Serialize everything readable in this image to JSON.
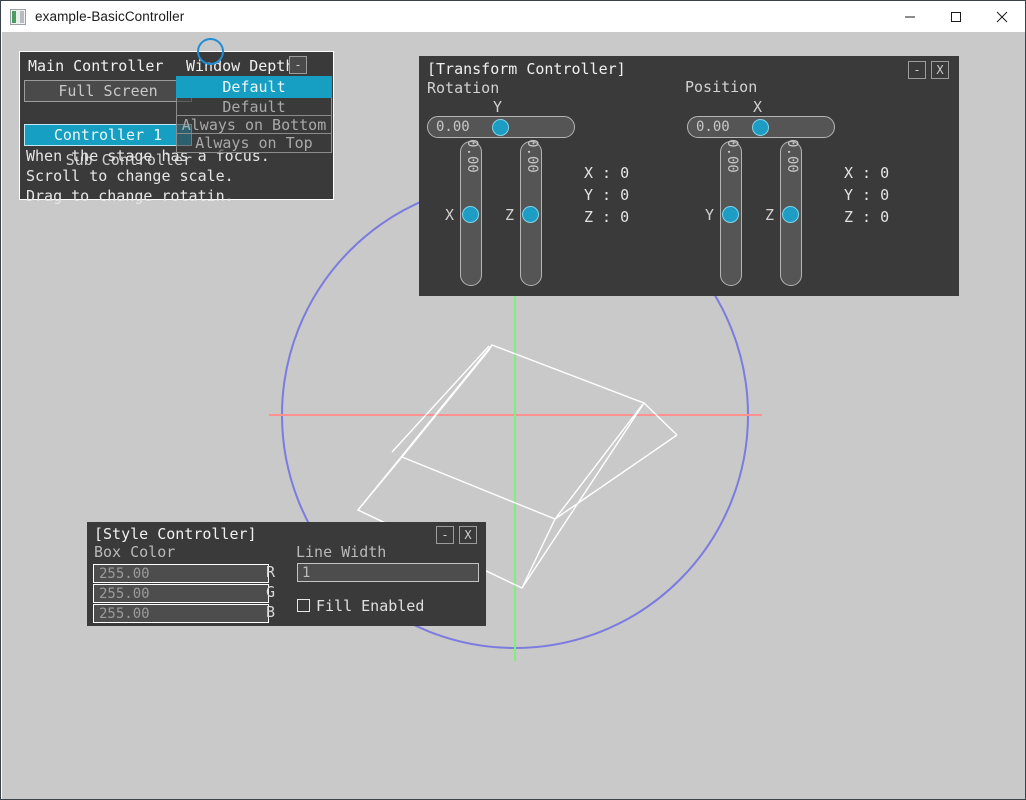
{
  "window": {
    "title": "example-BasicController",
    "icon": "app-icon",
    "buttons": [
      {
        "name": "minimize",
        "glyph": "minimize-icon"
      },
      {
        "name": "maximize",
        "glyph": "maximize-icon"
      },
      {
        "name": "close",
        "glyph": "close-icon"
      }
    ]
  },
  "colors": {
    "stage_bg": "#c9c9c9",
    "panel_bg": "#3a3a3a",
    "accent_cyan": "#169fc2",
    "knob_cyan": "#1d9dc4",
    "drag_handle_blue": "#1f8ed6",
    "axis_x_red": "#ff8f8f",
    "axis_y_green": "#7bf07b",
    "circle_blue": "#7b7be0",
    "wire_white": "#ffffff"
  },
  "main_controller": {
    "title": "Main Controller",
    "depth_label": "Window Depth",
    "depth_button": "-",
    "full_screen_button": "Full Screen",
    "sub_label": "Sub Controller",
    "controller_button": "Controller 1",
    "hints": [
      "When the stage has a focus.",
      "Scroll to change scale.",
      "Drag to change rotatin."
    ],
    "dropdown": {
      "selected": "Default",
      "options": [
        "Default",
        "Always on Bottom",
        "Always on Top"
      ]
    }
  },
  "transform_controller": {
    "title": "[Transform Controller]",
    "buttons": {
      "minimize": "-",
      "close": "X"
    },
    "rotation": {
      "section_label": "Rotation",
      "h_axis": "Y",
      "h_value": "0.00",
      "v_axes": [
        "X",
        "Z"
      ],
      "v_values": [
        "0.00",
        "0.00"
      ],
      "readout": [
        {
          "axis": "X",
          "value": "0"
        },
        {
          "axis": "Y",
          "value": "0"
        },
        {
          "axis": "Z",
          "value": "0"
        }
      ]
    },
    "position": {
      "section_label": "Position",
      "h_axis": "X",
      "h_value": "0.00",
      "v_axes": [
        "Y",
        "Z"
      ],
      "v_values": [
        "0.00",
        "0.00"
      ],
      "readout": [
        {
          "axis": "X",
          "value": "0"
        },
        {
          "axis": "Y",
          "value": "0"
        },
        {
          "axis": "Z",
          "value": "0"
        }
      ]
    }
  },
  "style_controller": {
    "title": "[Style Controller]",
    "buttons": {
      "minimize": "-",
      "close": "X"
    },
    "box_color_label": "Box Color",
    "channels": [
      {
        "tag": "R",
        "value": "255.00"
      },
      {
        "tag": "G",
        "value": "255.00"
      },
      {
        "tag": "B",
        "value": "255.00"
      }
    ],
    "line_width_label": "Line Width",
    "line_width_value": "1",
    "fill_enabled_label": "Fill Enabled",
    "fill_enabled_checked": false
  }
}
